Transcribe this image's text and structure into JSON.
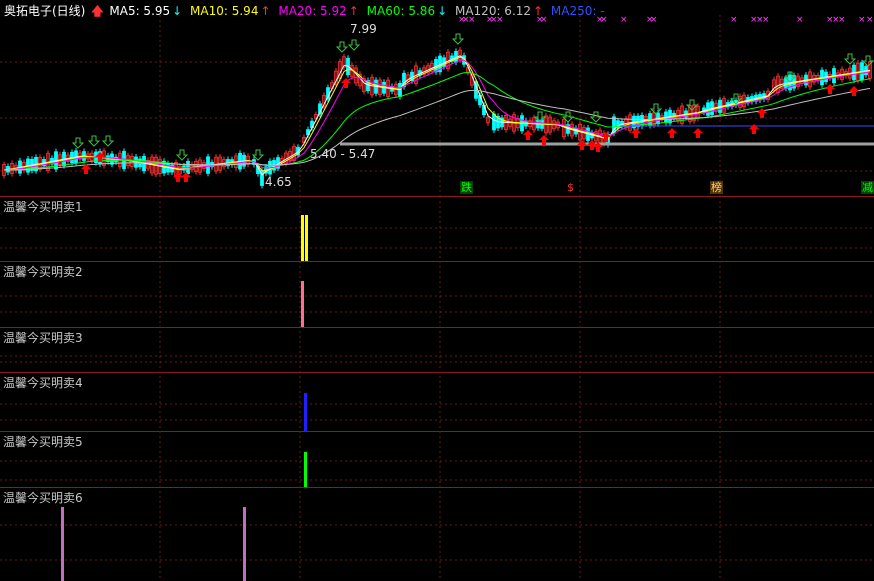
{
  "header": {
    "title": "奥拓电子(日线)",
    "ma": [
      {
        "label": "MA5: 5.95",
        "color": "#ffffff",
        "arrow": "↓",
        "arrow_color": "#00ffff"
      },
      {
        "label": "MA10: 5.94",
        "color": "#ffff00",
        "arrow": "↑",
        "arrow_color": "#ff3030"
      },
      {
        "label": "MA20: 5.92",
        "color": "#ff00ff",
        "arrow": "↑",
        "arrow_color": "#ff3030"
      },
      {
        "label": "MA60: 5.86",
        "color": "#00ff00",
        "arrow": "↓",
        "arrow_color": "#00ffff"
      },
      {
        "label": "MA120: 6.12",
        "color": "#c0c0c0",
        "arrow": "↑",
        "arrow_color": "#ff3030"
      },
      {
        "label": "MA250: -",
        "color": "#3050ff",
        "arrow": "",
        "arrow_color": "#3050ff"
      }
    ]
  },
  "annotations": {
    "high": "7.99",
    "low": "4.65",
    "range": "5.40 - 5.47"
  },
  "tags": [
    {
      "text": "跌",
      "color": "#00ff00",
      "bg": "#004400"
    },
    {
      "text": "$",
      "color": "#ff3030",
      "bg": ""
    },
    {
      "text": "榜",
      "color": "#ffd27f",
      "bg": "#553300"
    },
    {
      "text": "减",
      "color": "#00ff00",
      "bg": "#004400"
    }
  ],
  "panels": [
    {
      "label": "温馨今买明卖1",
      "bar_color": "#ffff00"
    },
    {
      "label": "温馨今买明卖2",
      "bar_color": "#ff7090"
    },
    {
      "label": "温馨今买明卖3",
      "bar_color": ""
    },
    {
      "label": "温馨今买明卖4",
      "bar_color": "#2020ff"
    },
    {
      "label": "温馨今买明卖5",
      "bar_color": "#00ff00"
    },
    {
      "label": "温馨今买明卖6",
      "bar_color": "#c070c0"
    }
  ],
  "colors": {
    "background": "#000000",
    "separator": "#8b1a1a",
    "grid": "#6a1a1a",
    "up_candle": "#ff3030",
    "down_candle": "#00ffff",
    "buy_arrow": "#ff0000",
    "sell_arrow": "#40c040",
    "x_mark": "#ff40ff",
    "support_line": "#a0a0a0"
  }
}
